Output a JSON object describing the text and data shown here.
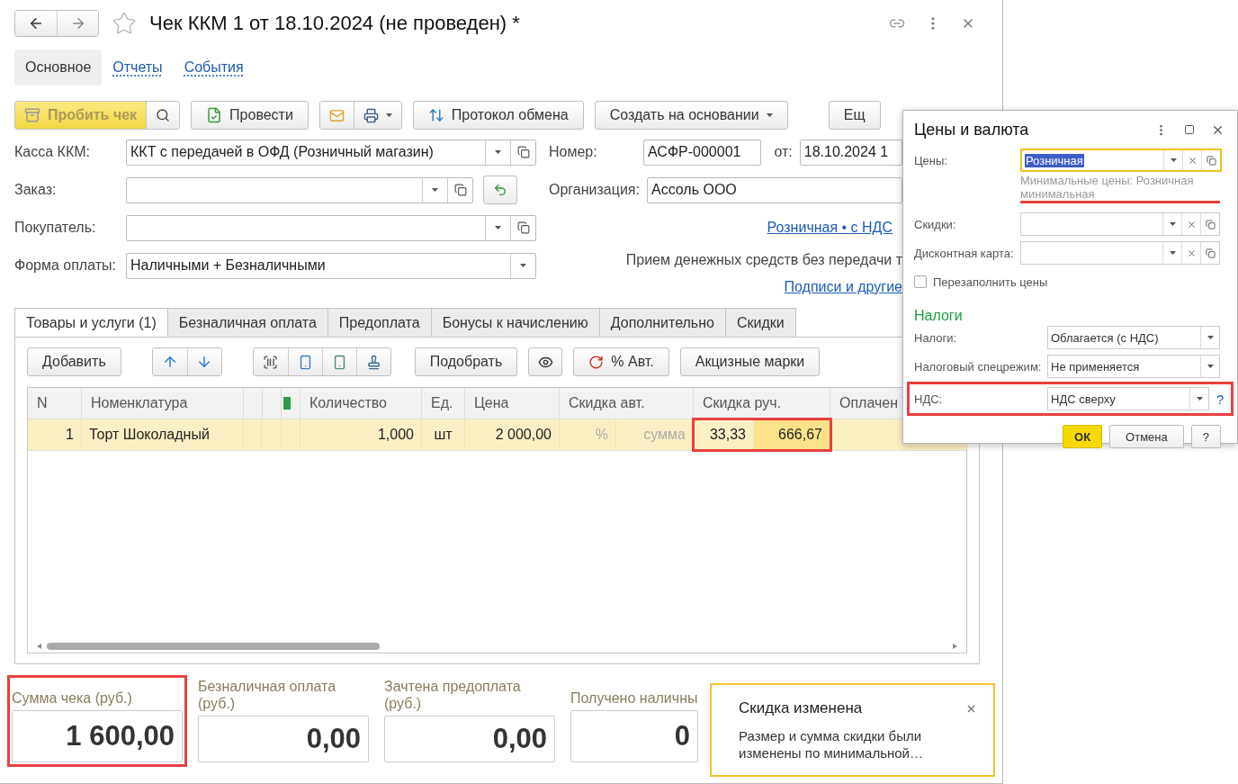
{
  "window": {
    "title": "Чек ККМ 1 от 18.10.2024 (не проведен) *"
  },
  "nav_tabs": [
    {
      "label": "Основное",
      "selected": true
    },
    {
      "label": "Отчеты",
      "selected": false
    },
    {
      "label": "События",
      "selected": false
    }
  ],
  "toolbar": {
    "print_check": "Пробить чек",
    "post": "Провести",
    "exchange_log": "Протокол обмена",
    "create_based": "Создать на основании",
    "more": "Ещ"
  },
  "fields": [
    {
      "label": "Касса ККМ:",
      "value": "ККТ с передачей в ОФД (Розничный магазин)",
      "kind": "select_open"
    },
    {
      "label": "Заказ:",
      "kind": "select_open_fill"
    },
    {
      "label": "Покупатель:",
      "kind": "select_open"
    },
    {
      "label": "Форма оплаты:",
      "value": "Наличными + Безналичными",
      "kind": "select"
    }
  ],
  "header_right": {
    "number_label": "Номер:",
    "number": "АСФР-000001",
    "date_label": "от:",
    "date": "18.10.2024 1",
    "org_label": "Организация:",
    "org": "Ассоль ООО",
    "price_link": "Розничная • с НДС",
    "payment_note": "Прием денежных средств без передачи т",
    "signatures_link": "Подписи и другие"
  },
  "doc_tabs": [
    {
      "label": "Товары и услуги (1)",
      "selected": true
    },
    {
      "label": "Безналичная оплата",
      "selected": false
    },
    {
      "label": "Предоплата",
      "selected": false
    },
    {
      "label": "Бонусы к начислению",
      "selected": false
    },
    {
      "label": "Дополнительно",
      "selected": false
    },
    {
      "label": "Скидки",
      "selected": false
    }
  ],
  "table_toolbar": {
    "add": "Добавить",
    "pick": "Подобрать",
    "auto_discount": "% Авт.",
    "excise": "Акцизные марки"
  },
  "table": {
    "columns": [
      "N",
      "Номенклатура",
      "Количество",
      "Ед.",
      "Цена",
      "Скидка авт.",
      "Скидка руч.",
      "Оплачен"
    ],
    "rows": [
      {
        "n": "1",
        "item": "Торт Шоколадный",
        "qty": "1,000",
        "unit": "шт",
        "price": "2 000,00",
        "auto_pct": "%",
        "auto_sum": "сумма",
        "manual_pct": "33,33",
        "manual_sum": "666,67",
        "selected": true,
        "annotated": true
      }
    ]
  },
  "totals": [
    {
      "label": "Сумма чека (руб.)",
      "value": "1 600,00",
      "annotated": true
    },
    {
      "label": "Безналичная оплата (руб.)",
      "value": "0,00",
      "annotated": false
    },
    {
      "label": "Зачтена предоплата (руб.)",
      "value": "0,00",
      "annotated": false
    },
    {
      "label": "Получено наличны",
      "value": "0",
      "annotated": false
    }
  ],
  "dialog": {
    "title": "Цены и валюта",
    "prices_label": "Цены:",
    "prices": "Розничная",
    "prices_hint": "Минимальные цены: Розничная минимальная",
    "discounts_label": "Скидки:",
    "card_label": "Дисконтная карта:",
    "refill": {
      "label": "Перезаполнить цены",
      "checked": false
    },
    "taxes_heading": "Налоги",
    "taxes_label": "Налоги:",
    "taxes": "Облагается (с НДС)",
    "regime_label": "Налоговый спецрежим:",
    "regime": "Не применяется",
    "vat_label": "НДС:",
    "vat": "НДС сверху",
    "vat_help": "?",
    "ok": "ОК",
    "cancel": "Отмена",
    "help": "?"
  },
  "notification": {
    "title": "Скидка изменена",
    "text": "Размер и сумма скидки были изменены по минимальной…"
  }
}
